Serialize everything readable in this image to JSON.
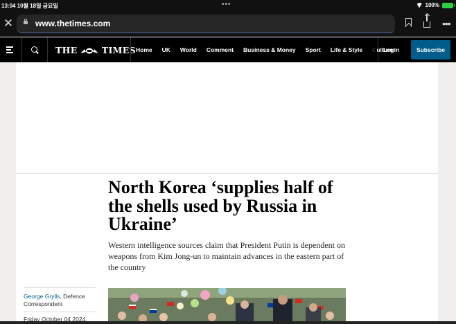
{
  "status_bar": {
    "time": "13:04",
    "date": "10월 18일 금요일",
    "battery": "100%"
  },
  "browser": {
    "url": "www.thetimes.com"
  },
  "nav": {
    "logo_left": "THE",
    "logo_right": "TIMES",
    "links": [
      "Home",
      "UK",
      "World",
      "Comment",
      "Business & Money",
      "Sport",
      "Life & Style",
      "Culture"
    ],
    "login": "Login",
    "subscribe": "Subscribe",
    "subscribe_color": "#005c8a"
  },
  "article": {
    "headline": "North Korea ‘supplies half of the shells used by Russia in Ukraine’",
    "standfirst": "Western intelligence sources claim that President Putin is dependent on weapons from Kim Jong-un to maintain advances in the eastern part of the country",
    "author": "George Grylls",
    "author_role": ", Defence Correspondent",
    "date": "Friday October 04 2024,"
  }
}
